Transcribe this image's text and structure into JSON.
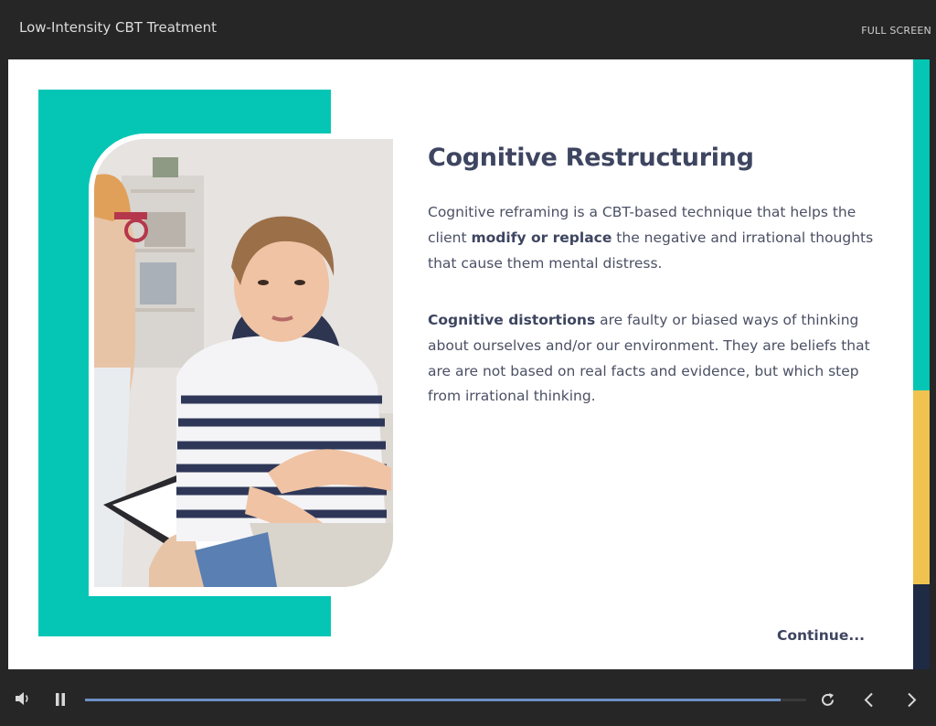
{
  "header": {
    "course_title": "Low-Intensity CBT Treatment",
    "fullscreen_label": "FULL SCREEN"
  },
  "slide": {
    "heading": "Cognitive Restructuring",
    "para1": {
      "before": "Cognitive reframing is a CBT-based technique that helps the client ",
      "bold": "modify or replace",
      "after": " the negative and irrational thoughts that cause them mental distress."
    },
    "para2": {
      "bold": "Cognitive distortions",
      "after": " are faulty or biased ways of thinking about ourselves and/or our environment. They are beliefs that are are not based on real facts and evidence, but which step from irrational thinking."
    },
    "continue_label": "Continue..."
  },
  "accent_strip": {
    "colors": [
      "#05c6b5",
      "#f0c350",
      "#1f2a44"
    ],
    "fractions": [
      0.542,
      0.318,
      0.14
    ]
  },
  "controls": {
    "progress_fraction": 0.965,
    "icons": [
      "volume-icon",
      "pause-icon",
      "replay-icon",
      "chevron-left-icon",
      "chevron-right-icon"
    ]
  },
  "colors": {
    "teal": "#05c6b5",
    "heading": "#3e4560",
    "progress": "#6c8fc4"
  }
}
